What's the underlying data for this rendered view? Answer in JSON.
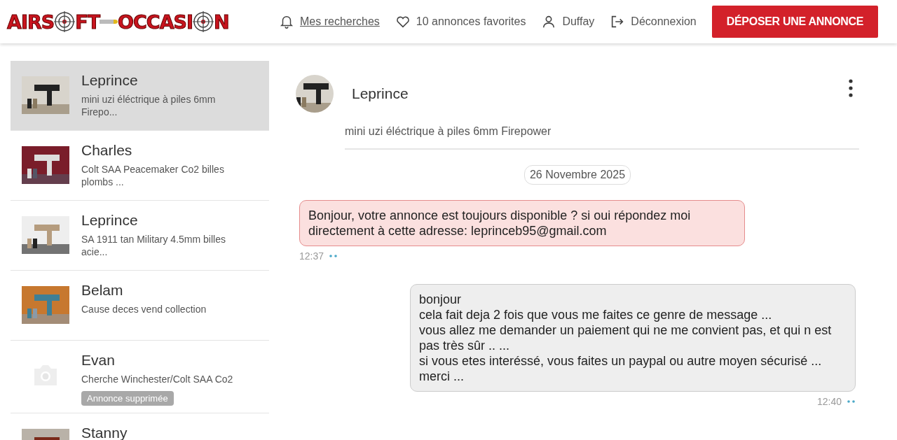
{
  "header": {
    "logo": [
      "AIRS",
      "FT",
      "OCCASI",
      "N"
    ],
    "nav": [
      {
        "kind": "bell",
        "label": "Mes recherches",
        "underlined": true
      },
      {
        "kind": "heart",
        "label": "10 annonces favorites",
        "underlined": false
      },
      {
        "kind": "user",
        "label": "Duffay",
        "underlined": false
      },
      {
        "kind": "logout",
        "label": "Déconnexion",
        "underlined": false
      }
    ],
    "cta": "DÉPOSER UNE ANNONCE"
  },
  "conversations": [
    {
      "name": "Leprince",
      "subject": "mini uzi éléctrique à piles 6mm Firepo...",
      "selected": true
    },
    {
      "name": "Charles",
      "subject": "Colt SAA Peacemaker Co2 billes plombs ...",
      "selected": false
    },
    {
      "name": "Leprince",
      "subject": "SA 1911 tan Military 4.5mm billes acie...",
      "selected": false
    },
    {
      "name": "Belam",
      "subject": "Cause deces vend collection",
      "selected": false
    },
    {
      "name": "Evan",
      "subject": "Cherche Winchester/Colt SAA Co2",
      "selected": false,
      "kind": "placeholder",
      "badge": "Annonce supprimée"
    },
    {
      "name": "Stanny",
      "selected": false
    }
  ],
  "chat": {
    "name": "Leprince",
    "subject": "mini uzi éléctrique à piles 6mm Firepower",
    "date": "26 Novembre 2025",
    "messages": [
      {
        "kind": "received",
        "flagged": true,
        "lines": [
          "Bonjour, votre annonce est toujours disponible ? si oui répondez moi directement à cette adresse: leprinceb95@gmail.com"
        ],
        "time": "12:37"
      },
      {
        "kind": "sent",
        "flagged": false,
        "lines": [
          "bonjour",
          "cela fait deja 2 fois que vous me faites ce genre de message ...",
          "vous allez me demander un paiement qui ne me convient pas, et qui n est pas très sûr .. ...",
          "si vous etes interéssé, vous faites un paypal ou autre moyen sécurisé ...",
          "merci ..."
        ],
        "time": "12:40"
      }
    ]
  }
}
